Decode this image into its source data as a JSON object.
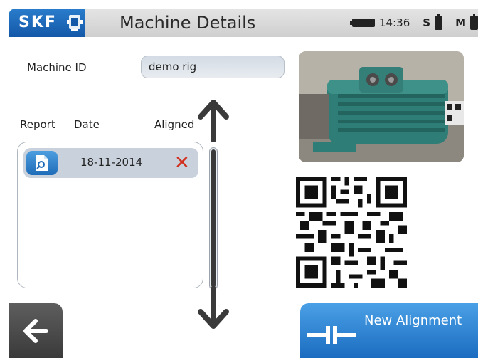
{
  "header": {
    "brand": "SKF",
    "title": "Machine Details",
    "time": "14:36",
    "s_label": "S",
    "m_label": "M"
  },
  "machine": {
    "id_label": "Machine ID",
    "id_value": "demo rig"
  },
  "report_table": {
    "headers": {
      "report": "Report",
      "date": "Date",
      "aligned": "Aligned"
    },
    "rows": [
      {
        "date": "18-11-2014",
        "aligned_icon": "x-mark-icon"
      }
    ]
  },
  "actions": {
    "new_alignment_label": "New Alignment"
  },
  "icons": {
    "machine": "machine-icon",
    "battery_main": "battery-icon",
    "battery_s": "battery-icon",
    "battery_m": "battery-icon",
    "report": "report-document-icon",
    "delete": "x-mark-icon",
    "scroll_up": "arrow-up-icon",
    "scroll_down": "arrow-down-icon",
    "back": "arrow-left-icon",
    "alignment": "coupling-icon"
  },
  "colors": {
    "brand_blue": "#1458a8",
    "accent_blue": "#2a7ccc",
    "delete_red": "#d2301f",
    "row_bg": "#c9d2dc"
  }
}
